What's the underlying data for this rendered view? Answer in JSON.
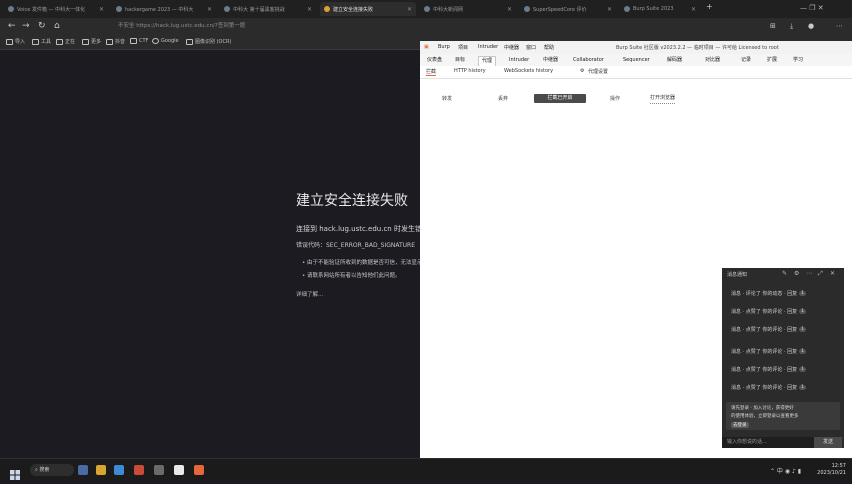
{
  "browser": {
    "tabs": [
      {
        "label": "Voice 发件箱 — 中科大一体化"
      },
      {
        "label": "hackergame 2023 — 中科大"
      },
      {
        "label": "中科大 第十届黑客挑战"
      },
      {
        "label": "建立安全连接失败"
      },
      {
        "label": "中科大新闻网"
      },
      {
        "label": "SuperSpeedCore 评价"
      },
      {
        "label": "Burp Suite 2023"
      }
    ],
    "url": "不安全 https://hack.lug.ustc.edu.cn/?签到第一题",
    "bookmarks": [
      "导入",
      "工具",
      "正在",
      "更多",
      "抖音",
      "CTF",
      "Google",
      "图像识别 (OCR)"
    ],
    "window_controls": "— ❐ ✕"
  },
  "error_page": {
    "title": "建立安全连接失败",
    "description": "连接到 hack.lug.ustc.edu.cn 时发生错误。",
    "code": "错误代码：SEC_ERROR_BAD_SIGNATURE",
    "bullets": [
      "由于不能验证所收到的数据是否可信，无法显示此页面。",
      "请联系网站所有者以告知他们此问题。"
    ],
    "learn_more": "详细了解…"
  },
  "burp": {
    "menu": [
      "Burp",
      "项目",
      "Intruder",
      "中继器",
      "窗口",
      "帮助"
    ],
    "title": "Burp Suite 社区版 v2023.2.2 — 临时项目 — 许可给 Licensed to root",
    "main_tabs": [
      "仪表盘",
      "目标",
      "代理",
      "Intruder",
      "中继器",
      "Collaborator",
      "Sequencer",
      "解码器",
      "对比器",
      "记录",
      "扩展",
      "学习"
    ],
    "sub_tabs": [
      "拦截",
      "HTTP history",
      "WebSockets history",
      "代理设置"
    ],
    "actions": [
      "转发",
      "丢弃",
      "拦截已开启",
      "操作",
      "打开浏览器"
    ]
  },
  "notifications": {
    "header": "消息通知",
    "items": [
      "消息 · 评论了 你的动态 · 回复",
      "消息 · 点赞了 你的评论 · 回复",
      "消息 · 点赞了 你的评论 · 回复",
      "消息 · 点赞了 你的评论 · 回复",
      "消息 · 点赞了 你的评论 · 回复",
      "消息 · 点赞了 你的评论 · 回复"
    ],
    "pill": "1",
    "box_lines": [
      "请先登录 · 加入讨论，获得更好",
      "的使用体验，立即登录以查看更多"
    ],
    "box_button": "去登录",
    "input_placeholder": "输入你想说的话…",
    "send_label": "发送"
  },
  "taskbar": {
    "search_label": "搜索",
    "time": "12:57",
    "date": "2023/10/21"
  },
  "colors": {
    "page_bg": "#1c1b22",
    "burp_accent": "#e8673a"
  }
}
